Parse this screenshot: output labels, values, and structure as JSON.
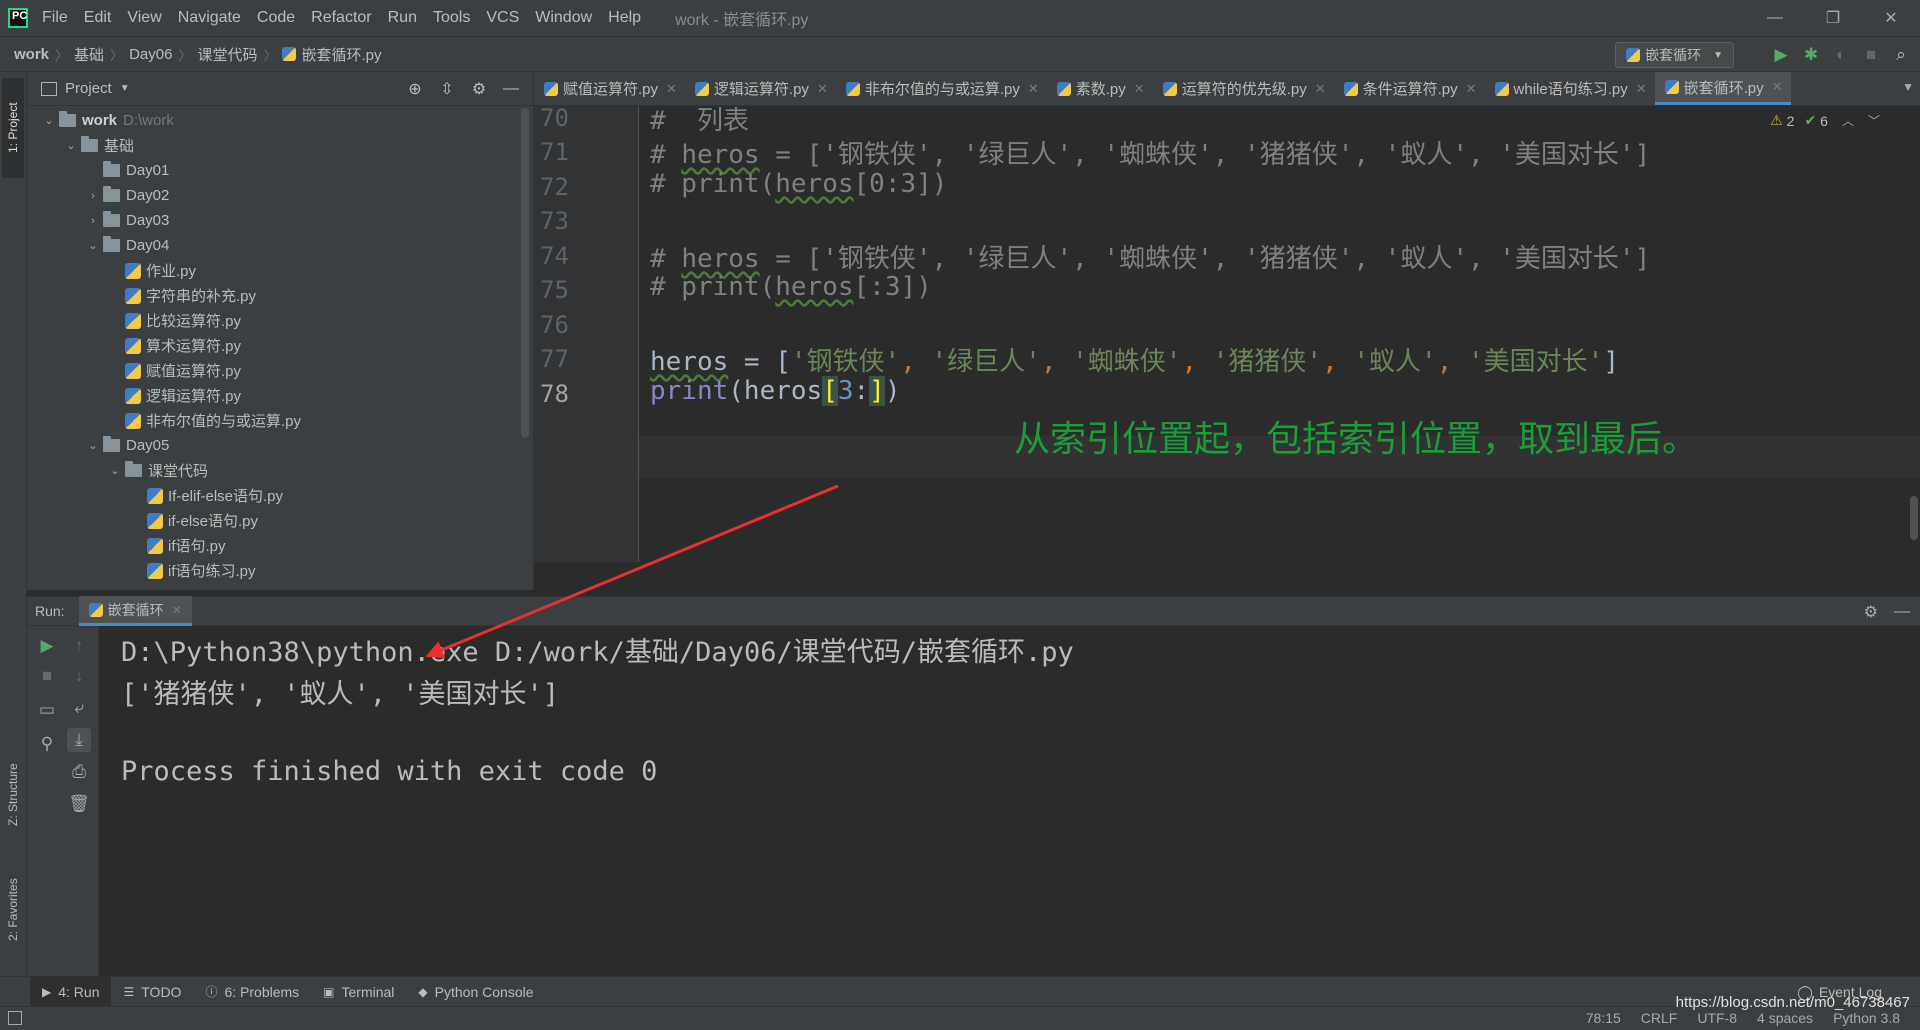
{
  "menubar": {
    "items": [
      "File",
      "Edit",
      "View",
      "Navigate",
      "Code",
      "Refactor",
      "Run",
      "Tools",
      "VCS",
      "Window",
      "Help"
    ],
    "title": "work - 嵌套循环.py",
    "logo_text": "PC",
    "icons": [
      "minimize-icon",
      "restore-icon",
      "close-icon"
    ]
  },
  "navbar": {
    "crumbs": [
      "work",
      "基础",
      "Day06",
      "课堂代码",
      "嵌套循环.py"
    ],
    "run_config": "嵌套循环"
  },
  "left_stripe": {
    "project": "1: Project",
    "structure": "Z: Structure",
    "favorites": "2: Favorites"
  },
  "project": {
    "header": "Project",
    "tree": [
      {
        "label": "work",
        "hint": "D:\\work",
        "type": "folder",
        "depth": 0,
        "expanded": true,
        "bold": true
      },
      {
        "label": "基础",
        "type": "folder",
        "depth": 1,
        "expanded": true
      },
      {
        "label": "Day01",
        "type": "folder",
        "depth": 2,
        "expanded": null
      },
      {
        "label": "Day02",
        "type": "folder",
        "depth": 2,
        "expanded": false
      },
      {
        "label": "Day03",
        "type": "folder",
        "depth": 2,
        "expanded": false
      },
      {
        "label": "Day04",
        "type": "folder",
        "depth": 2,
        "expanded": true
      },
      {
        "label": "作业.py",
        "type": "file",
        "depth": 3
      },
      {
        "label": "字符串的补充.py",
        "type": "file",
        "depth": 3
      },
      {
        "label": "比较运算符.py",
        "type": "file",
        "depth": 3
      },
      {
        "label": "算术运算符.py",
        "type": "file",
        "depth": 3
      },
      {
        "label": "赋值运算符.py",
        "type": "file",
        "depth": 3
      },
      {
        "label": "逻辑运算符.py",
        "type": "file",
        "depth": 3
      },
      {
        "label": "非布尔值的与或运算.py",
        "type": "file",
        "depth": 3
      },
      {
        "label": "Day05",
        "type": "folder",
        "depth": 2,
        "expanded": true
      },
      {
        "label": "课堂代码",
        "type": "folder",
        "depth": 3,
        "expanded": true
      },
      {
        "label": "If-elif-else语句.py",
        "type": "file",
        "depth": 4
      },
      {
        "label": "if-else语句.py",
        "type": "file",
        "depth": 4
      },
      {
        "label": "if语句.py",
        "type": "file",
        "depth": 4
      },
      {
        "label": "if语句练习.py",
        "type": "file",
        "depth": 4
      }
    ]
  },
  "editor_tabs": [
    {
      "label": "赋值运算符.py",
      "active": false
    },
    {
      "label": "逻辑运算符.py",
      "active": false
    },
    {
      "label": "非布尔值的与或运算.py",
      "active": false
    },
    {
      "label": "素数.py",
      "active": false
    },
    {
      "label": "运算符的优先级.py",
      "active": false
    },
    {
      "label": "条件运算符.py",
      "active": false
    },
    {
      "label": "while语句练习.py",
      "active": false
    },
    {
      "label": "嵌套循环.py",
      "active": true
    }
  ],
  "inspections": {
    "warnings": "2",
    "ok": "6"
  },
  "editor": {
    "line_numbers": [
      "70",
      "71",
      "72",
      "73",
      "74",
      "75",
      "76",
      "77",
      "78"
    ],
    "current_line": "78",
    "l70": "#  列表",
    "l71_prefix": "# ",
    "l71_var": "heros",
    "l71_rest": " = ['钢铁侠', '绿巨人', '蜘蛛侠', '猪猪侠', '蚁人', '美国对长']",
    "l72_prefix": "# print(",
    "l72_var": "heros",
    "l72_rest": "[0:3])",
    "l74_prefix": "# ",
    "l74_var": "heros",
    "l74_rest": " = ['钢铁侠', '绿巨人', '蜘蛛侠', '猪猪侠', '蚁人', '美国对长']",
    "l75_prefix": "# print(",
    "l75_var": "heros",
    "l75_rest": "[:3])",
    "l77_var": "heros",
    "l77_eq": " = [",
    "l77_items": [
      "'钢铁侠'",
      "'绿巨人'",
      "'蜘蛛侠'",
      "'猪猪侠'",
      "'蚁人'",
      "'美国对长'"
    ],
    "l77_close": "]",
    "l78_func": "print",
    "l78_open": "(heros",
    "l78_lb": "[",
    "l78_num": "3",
    "l78_colon": ":",
    "l78_rb": "]",
    "l78_close": ")",
    "annotation": "从索引位置起，包括索引位置，取到最后。"
  },
  "run": {
    "label": "Run:",
    "tab": "嵌套循环",
    "console": [
      "D:\\Python38\\python.exe D:/work/基础/Day06/课堂代码/嵌套循环.py",
      "['猪猪侠', '蚁人', '美国对长']",
      "",
      "Process finished with exit code 0"
    ]
  },
  "bottom_tabs": [
    {
      "label": "4: Run",
      "active": true,
      "icon": "play-icon"
    },
    {
      "label": "TODO",
      "active": false,
      "icon": "list-icon"
    },
    {
      "label": "6: Problems",
      "active": false,
      "icon": "problems-icon"
    },
    {
      "label": "Terminal",
      "active": false,
      "icon": "terminal-icon"
    },
    {
      "label": "Python Console",
      "active": false,
      "icon": "python-icon"
    }
  ],
  "event_log": "Event Log",
  "status": {
    "position": "78:15",
    "line_sep": "CRLF",
    "encoding": "UTF-8",
    "indent": "4 spaces",
    "interpreter": "Python 3.8"
  },
  "watermark": "https://blog.csdn.net/m0_46738467",
  "colors": {
    "annotation": "#1b9e37",
    "arrow": "#e8302f",
    "accent": "#4a88c7"
  }
}
